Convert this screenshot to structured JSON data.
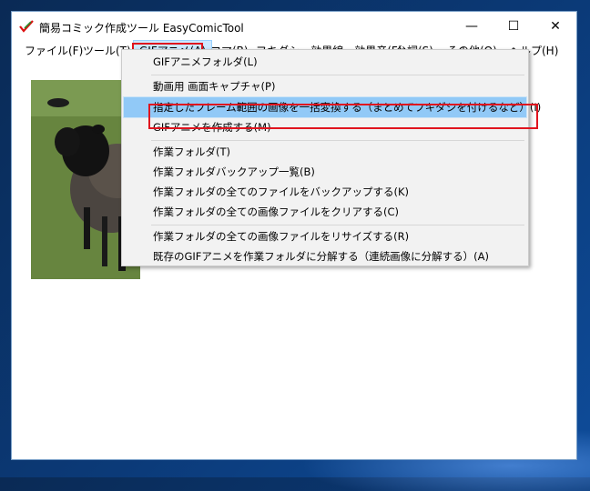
{
  "window": {
    "title": "簡易コミック作成ツール EasyComicTool"
  },
  "titlebar_buttons": {
    "minimize": "—",
    "maximize": "☐",
    "close": "✕"
  },
  "menubar": [
    "ファイル(F)",
    "ツール(T)",
    "GIFアニメ(A)",
    "コマ(B)",
    "フキダシ・効果線・効果音(F)",
    "台詞(S)",
    "その他(O)",
    "ヘルプ(H)"
  ],
  "open_menu": "GIFアニメ(A)",
  "dropdown": {
    "items": [
      "GIFアニメフォルダ(L)",
      "動画用 画面キャプチャ(P)",
      "指定したフレーム範囲の画像を一括変換する（まとめてフキダシを付けるなど）(I)",
      "GIFアニメを作成する(M)",
      "作業フォルダ(T)",
      "作業フォルダバックアップ一覧(B)",
      "作業フォルダの全てのファイルをバックアップする(K)",
      "作業フォルダの全ての画像ファイルをクリアする(C)",
      "作業フォルダの全ての画像ファイルをリサイズする(R)",
      "既存のGIFアニメを作業フォルダに分解する（連続画像に分解する）(A)"
    ],
    "highlighted_item": "指定したフレーム範囲の画像を一括変換する（まとめてフキダシを付けるなど）(I)"
  },
  "colors": {
    "highlight": "#91c9f7",
    "annotation_box": "#e0141e",
    "menu_open": "#cce8ff"
  },
  "icons": {
    "app": "checkmark-pencil-icon",
    "minimize": "minimize-icon",
    "maximize": "maximize-icon",
    "close": "close-icon"
  }
}
